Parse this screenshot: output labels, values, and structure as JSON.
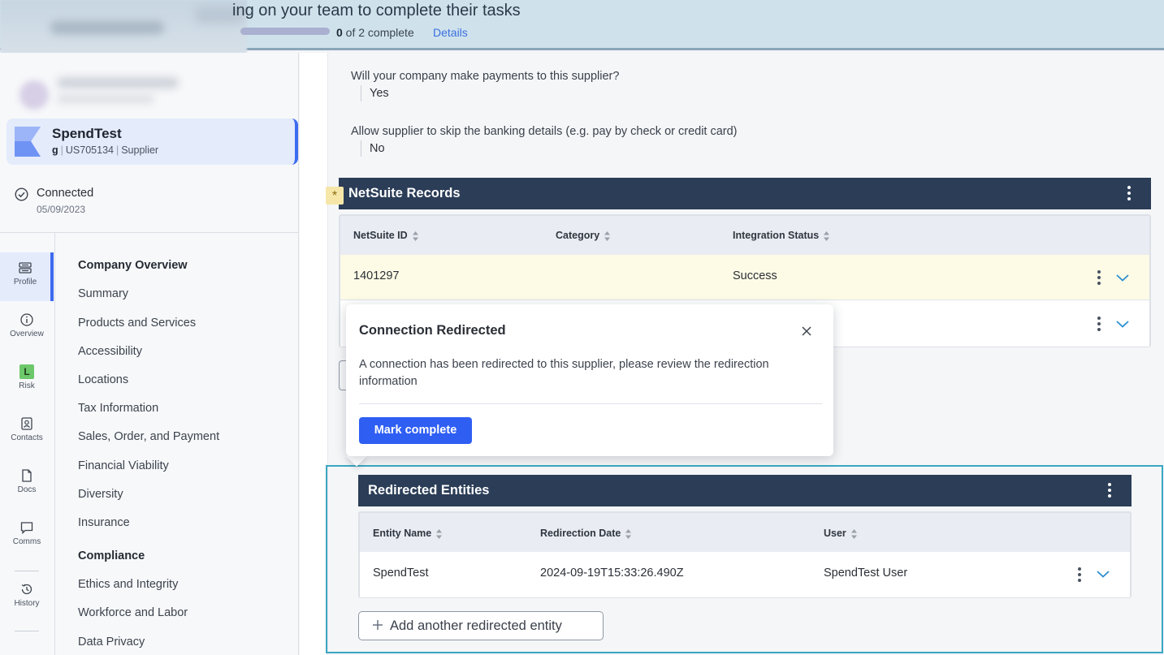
{
  "banner": {
    "title": "ing on your team to complete their tasks",
    "progress_count": "0",
    "progress_suffix": " of 2 complete",
    "progress_value": 0,
    "details_link": "Details"
  },
  "supplier": {
    "name": "SpendTest",
    "code_prefix": "g",
    "id": "US705134",
    "type": "Supplier"
  },
  "connection": {
    "status": "Connected",
    "date": "05/09/2023"
  },
  "rail": [
    {
      "label": "Profile",
      "icon": "profile-icon"
    },
    {
      "label": "Overview",
      "icon": "info-icon"
    },
    {
      "label": "Risk",
      "icon": "risk-badge",
      "badge": "L"
    },
    {
      "label": "Contacts",
      "icon": "contacts-icon"
    },
    {
      "label": "Docs",
      "icon": "document-icon"
    },
    {
      "label": "Comms",
      "icon": "chat-icon"
    },
    {
      "label": "History",
      "icon": "history-icon"
    }
  ],
  "nav": {
    "company_overview": "Company Overview",
    "items1": [
      "Summary",
      "Products and Services",
      "Accessibility",
      "Locations",
      "Tax Information",
      "Sales, Order, and Payment",
      "Financial Viability",
      "Diversity",
      "Insurance"
    ],
    "compliance": "Compliance",
    "items2": [
      "Ethics and Integrity",
      "Workforce and Labor",
      "Data Privacy"
    ]
  },
  "questions": [
    {
      "label": "Will your company make payments to this supplier?",
      "answer": "Yes"
    },
    {
      "label": "Allow supplier to skip the banking details (e.g. pay by check or credit card)",
      "answer": "No"
    }
  ],
  "netsuite": {
    "title": "NetSuite Records",
    "required_marker": "*",
    "columns": [
      "NetSuite ID",
      "Category",
      "Integration Status"
    ],
    "rows": [
      {
        "id": "1401297",
        "category": "",
        "status": "Success"
      },
      {
        "id": "",
        "category": "",
        "status": ""
      }
    ]
  },
  "popover": {
    "title": "Connection Redirected",
    "body": "A connection has been redirected to this supplier, please review the redirection information",
    "button": "Mark complete"
  },
  "redirected": {
    "title": "Redirected Entities",
    "columns": [
      "Entity Name",
      "Redirection Date",
      "User"
    ],
    "rows": [
      {
        "entity": "SpendTest",
        "date": "2024-09-19T15:33:26.490Z",
        "user": "SpendTest User"
      }
    ],
    "add_button": "Add another redirected entity"
  },
  "colors": {
    "accent": "#3d6bf0",
    "section_header": "#2b3d57",
    "highlight_row": "#fdfbe6",
    "focus_outline": "#3aa7c2"
  }
}
